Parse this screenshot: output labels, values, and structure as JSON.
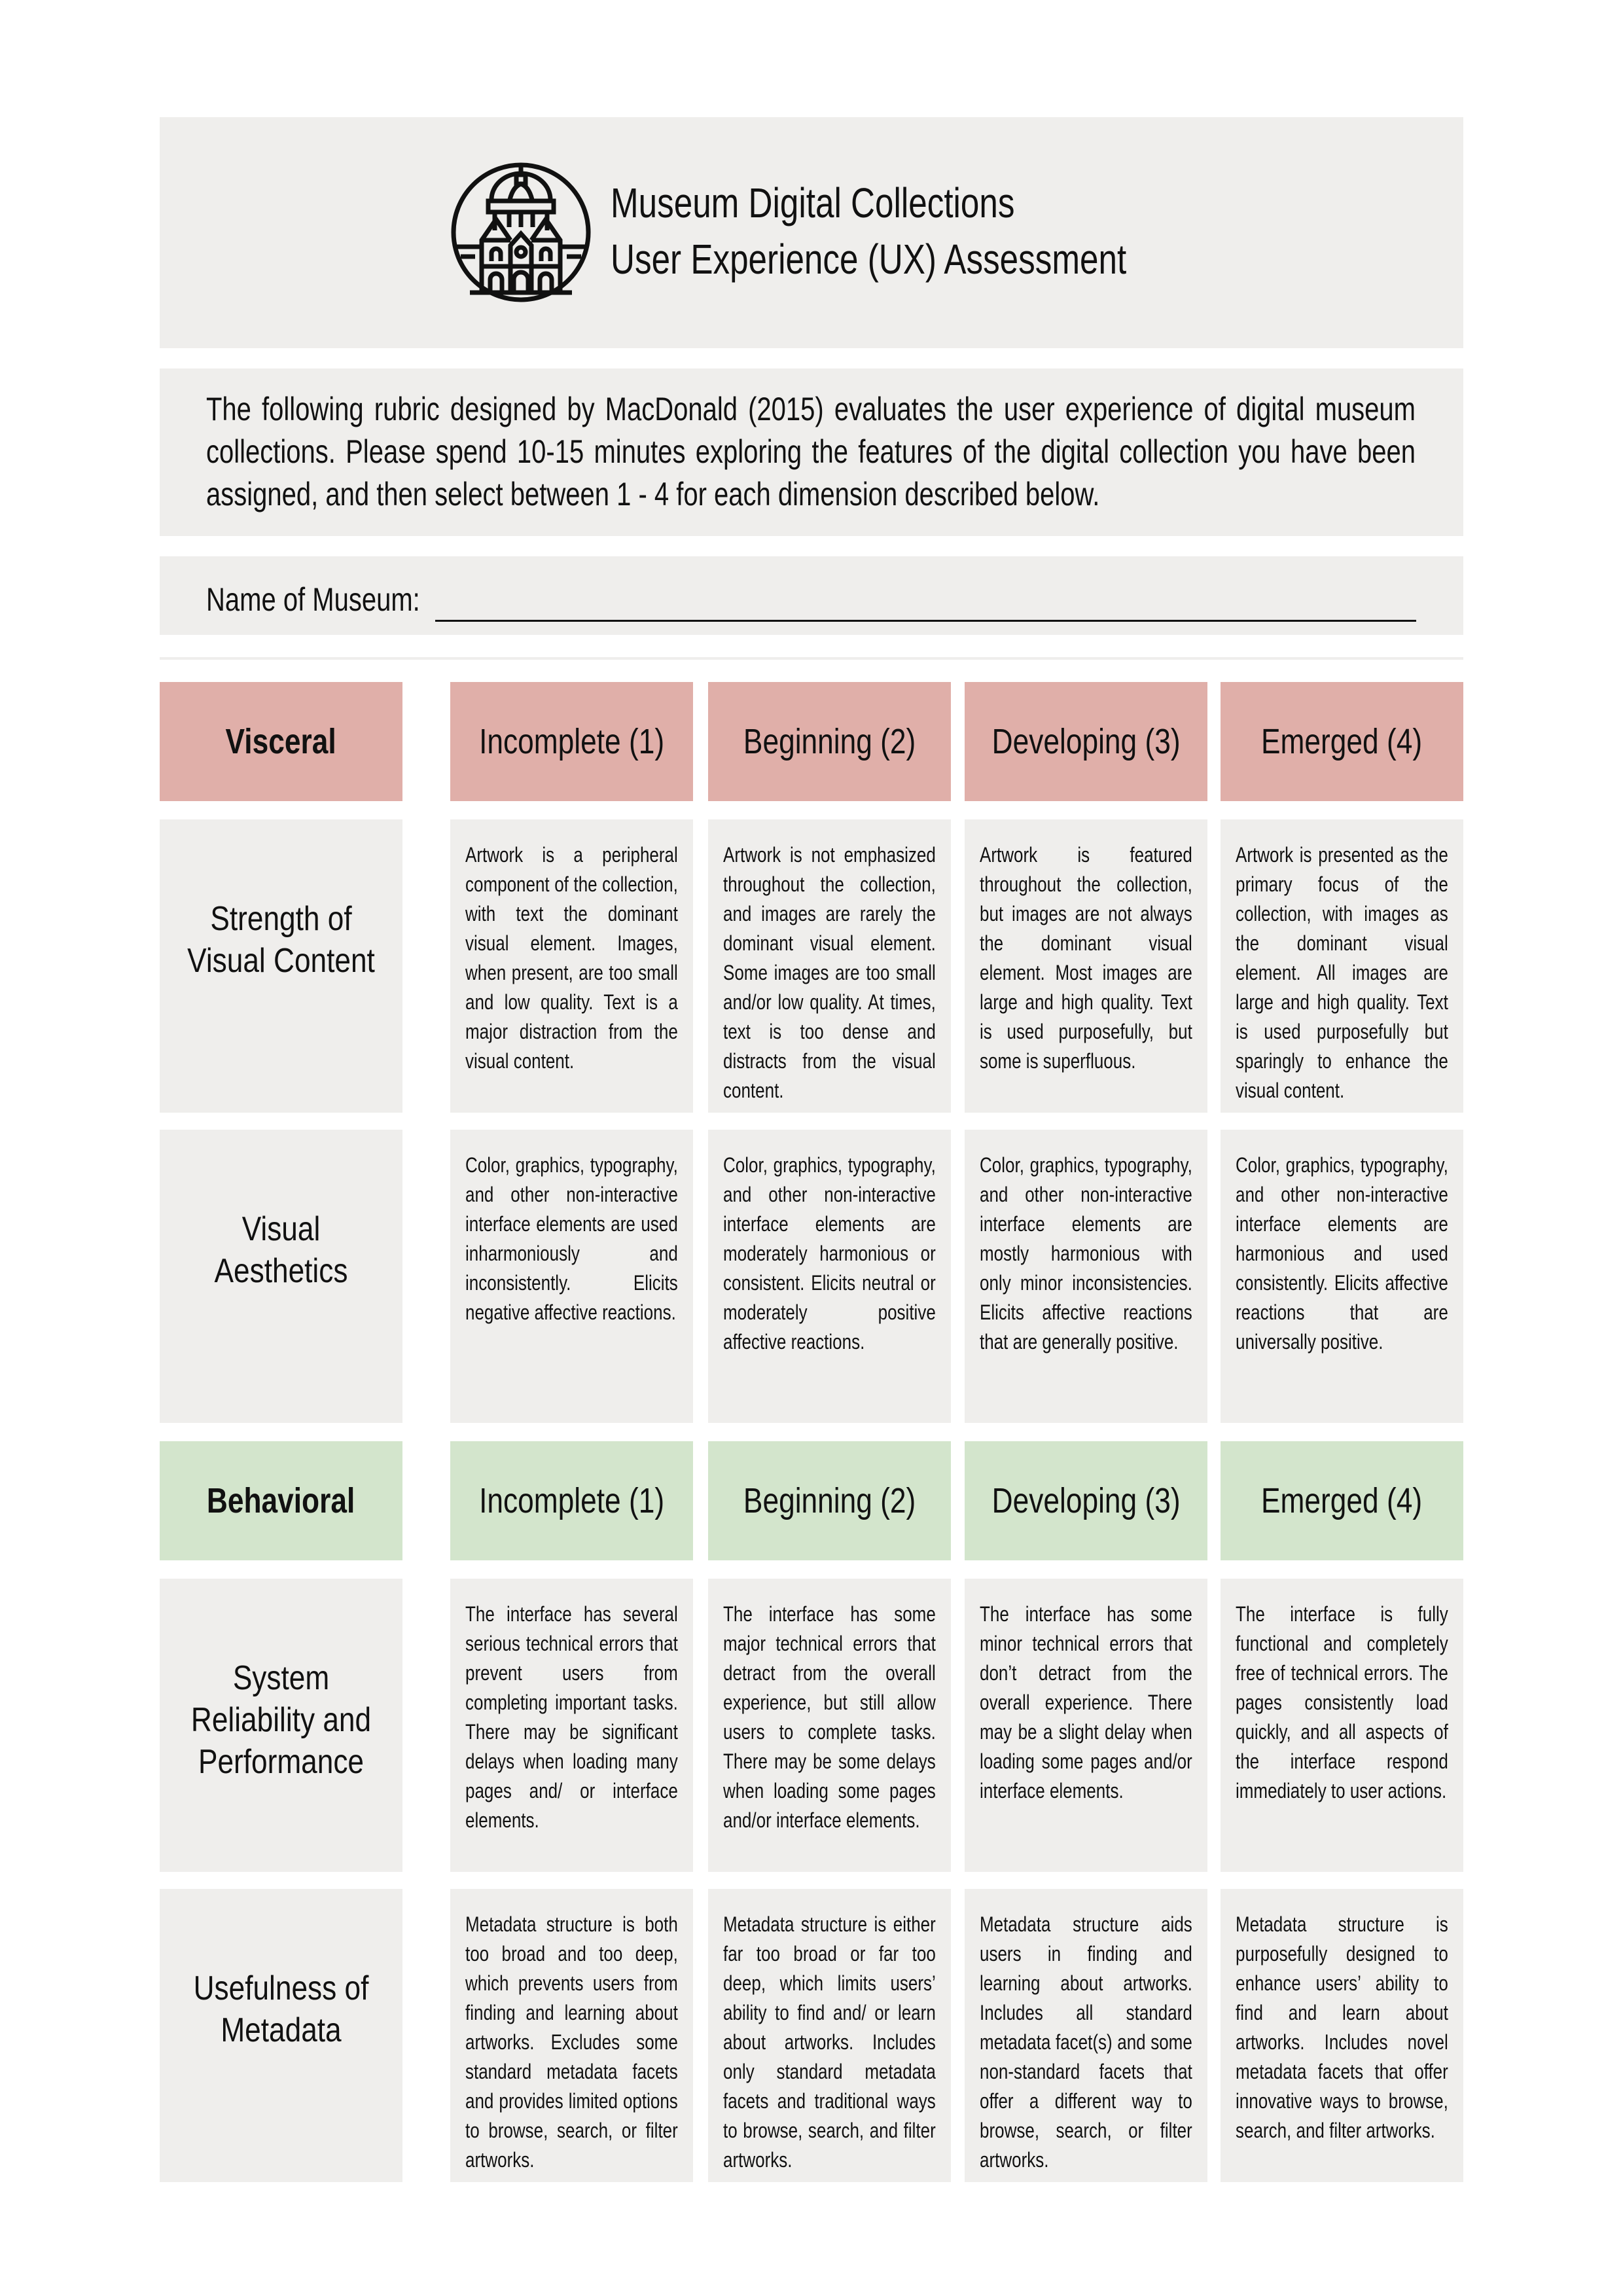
{
  "header": {
    "logo_icon": "museum-building-icon",
    "title_line1": "Museum Digital Collections",
    "title_line2": "User Experience (UX) Assessment"
  },
  "intro": {
    "text": "The following rubric designed by MacDonald (2015) evaluates the user experience of digital museum collections. Please spend 10-15 minutes exploring the features of the digital collection you have been assigned, and then select between 1 - 4 for each dimension described below."
  },
  "name_field": {
    "label": "Name of Museum:",
    "value": ""
  },
  "colors": {
    "panel": "#efeeec",
    "visceral_header": "#e0afa9",
    "behavioral_header": "#d3e5cc",
    "text": "#111111"
  },
  "sections": [
    {
      "name": "Visceral",
      "levels": [
        "Incomplete (1)",
        "Beginning (2)",
        "Developing (3)",
        "Emerged (4)"
      ],
      "rows": [
        {
          "dimension": "Strength of Visual Content",
          "cells": [
            "Artwork is a peripheral component of the col­lection, with text the dominant visual element. Images, when present, are too small and low quality. Text is a major distraction from the visual content.",
            "Artwork is not empha­sized throughout the collection, and images are rarely the dominant visual element. Some im­ages are too small and/or low quality. At times, text is too dense and distracts from the visual content.",
            "Artwork is featured throughout the collec­tion, but images are not always the dominant visual element. Most images are large and high quality. Text is used purposefully, but some is superfluous.",
            "Artwork is presented as the primary focus of the collection, with images as the dominant visual element. All images are large and high quality. Text is used purposefully but sparingly to enhance the visual content."
          ]
        },
        {
          "dimension": "Visual Aesthetics",
          "cells": [
            "Color, graphics, typogra­phy, and other non-inter­active interface elements are used inharmoniously and inconsistently. Elicits negative affective reac­tions.",
            "Color, graphics, typogra­phy, and other non-inter­active interface elements are moderately harmoni­ous or consistent. Elicits neutral or moderately positive affective reac­tions.",
            "Color, graphics, typogra­phy, and other non-inter­active interface elements are mostly harmonious with only minor inconsis­tencies. Elicits affective reactions that are gener­ally positive.",
            "Color, graphics, typogra­phy, and other non-inter­active interface elements are harmonious and used consistently. Elicits affec­tive reactions that are universally positive."
          ]
        }
      ]
    },
    {
      "name": "Behavioral",
      "levels": [
        "Incomplete (1)",
        "Beginning (2)",
        "Developing (3)",
        "Emerged (4)"
      ],
      "rows": [
        {
          "dimension": "System Reliability and Performance",
          "cells": [
            "The interface has several serious technical errors that prevent users from completing important tasks. There may be sig­nificant delays when loading many pages and/ or interface elements.",
            "The interface has some major technical errors that detract from the overall experience, but still allow users to com­plete tasks. There may be some delays when load­ing some pages and/or interface elements.",
            "The interface has some minor technical errors that don’t detract from the overall experience. There may be a slight delay when loading some pages and/or interface elements.",
            "The interface is fully functional and complete­ly free of technical errors. The pages consistently load quickly, and all as­pects of the interface respond immediately to user actions."
          ]
        },
        {
          "dimension": "Usefulness of Metadata",
          "cells": [
            "Metadata structure is both too broad and too deep, which prevents users from finding and learning about artworks. Excludes some standard metadata facets and provides limited op­tions to browse, search, or filter artworks.",
            "Metadata structure is ei­ther far too broad or far too deep, which limits users’ ability to find and/ or learn about artworks. Includes only standard metadata facets and tra­ditional ways to browse, search, and filter artworks.",
            "Metadata structure aids users in finding and learning about artworks. Includes all standard metadata facet(s) and some non-standard fac­ets that offer a different way to browse, search, or filter artworks.",
            "Metadata structure is purposefully designed to enhance users’ ability to find and learn about artworks. Includes nov­el metadata facets that offer innovative ways to browse, search, and filter artworks."
          ]
        }
      ]
    }
  ]
}
